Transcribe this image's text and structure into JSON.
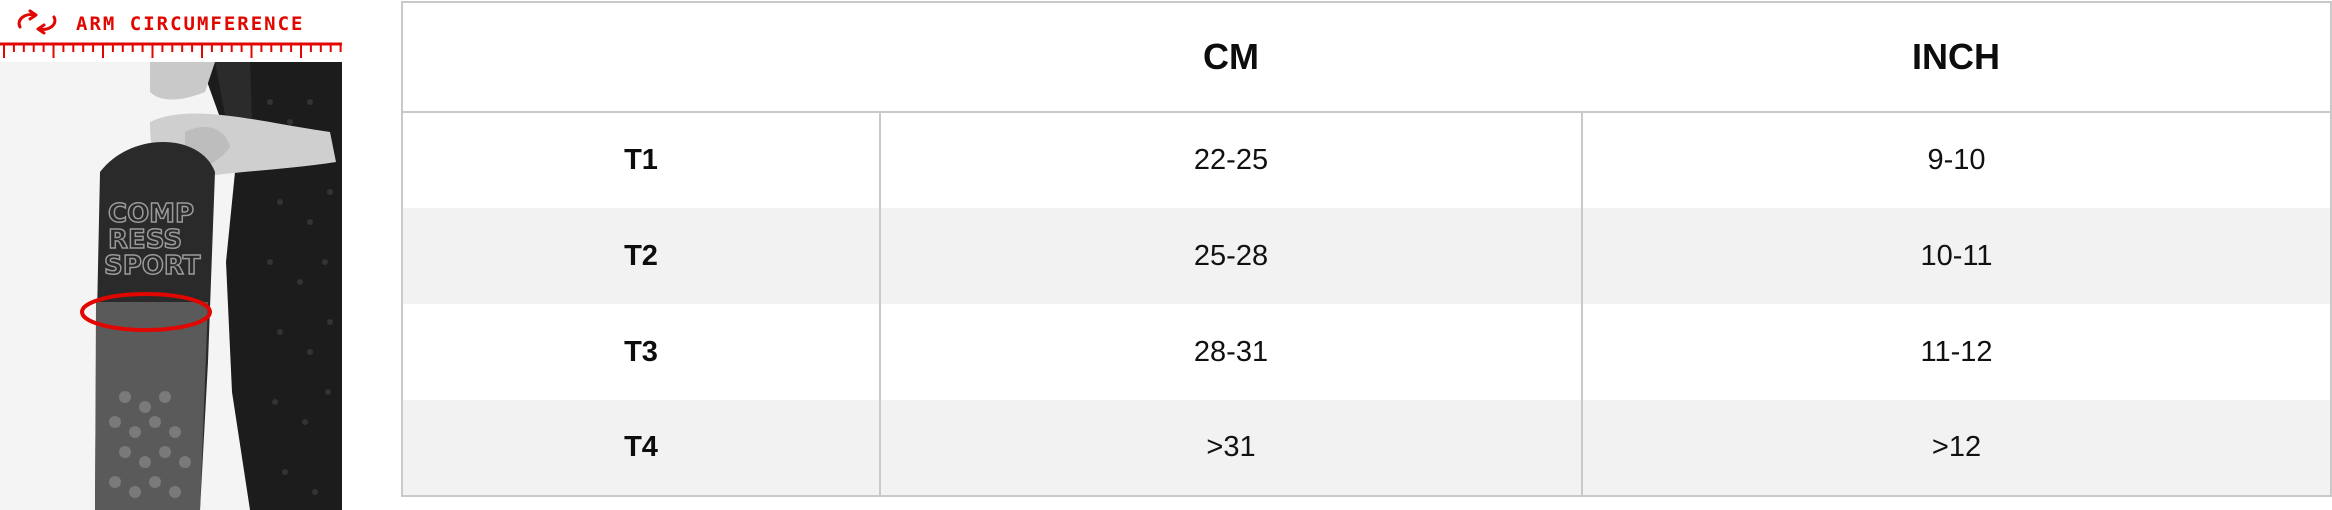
{
  "illustration": {
    "label": "ARM CIRCUMFERENCE",
    "icon": "circular-arrows-icon",
    "brand_text": [
      "COMP",
      "RESS",
      "SPORT"
    ],
    "accent_color": "#e10600"
  },
  "size_table": {
    "headers": [
      "",
      "CM",
      "INCH"
    ],
    "rows": [
      {
        "size": "T1",
        "cm": "22-25",
        "inch": "9-10"
      },
      {
        "size": "T2",
        "cm": "25-28",
        "inch": "10-11"
      },
      {
        "size": "T3",
        "cm": "28-31",
        "inch": "11-12"
      },
      {
        "size": "T4",
        "cm": ">31",
        "inch": ">12"
      }
    ],
    "colors": {
      "border": "#c9c9c9",
      "stripe": "#f2f2f2"
    }
  }
}
